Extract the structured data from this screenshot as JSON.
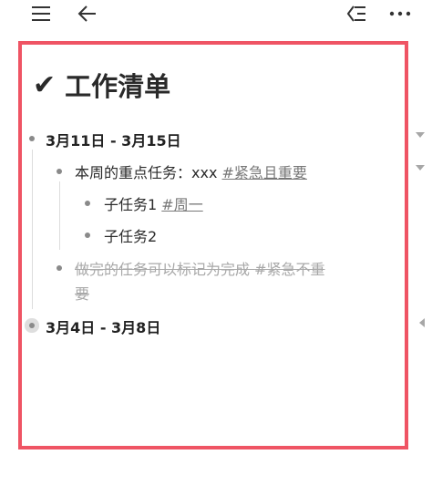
{
  "toolbar": {
    "menu_icon": "hamburger-menu-icon",
    "back_icon": "back-arrow-icon",
    "outline_icon": "outline-list-icon",
    "more_icon": "more-dots-icon"
  },
  "document": {
    "title_icon": "✔",
    "title": "工作清单",
    "items": [
      {
        "date": "3月11日 - 3月15日",
        "children": [
          {
            "text": "本周的重点任务：xxx ",
            "tag": "#紧急且重要",
            "children": [
              {
                "text": "子任务1 ",
                "tag": "#周一"
              },
              {
                "text": "子任务2"
              }
            ]
          },
          {
            "text_line1": "做完的任务可以标记为完成 ",
            "tag_line1": "#紧急不重",
            "tag_line2": "要",
            "completed": true
          }
        ]
      },
      {
        "date": "3月4日 - 3月8日",
        "collapsed": true
      }
    ]
  },
  "colors": {
    "frame_border": "#ef5464",
    "completed_text": "#a8a8a8",
    "tag_text": "#777777"
  }
}
